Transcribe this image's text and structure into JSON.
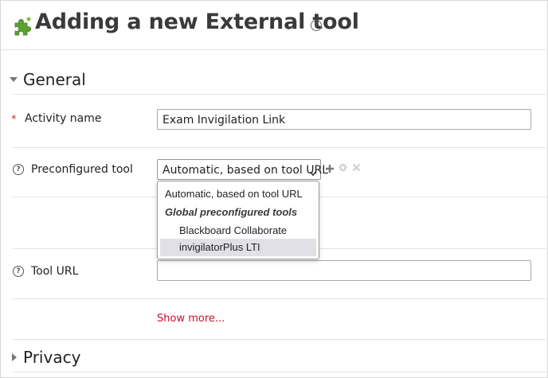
{
  "header": {
    "title": "Adding a new External tool",
    "help_glyph": "?"
  },
  "sections": {
    "general": {
      "label": "General"
    },
    "privacy": {
      "label": "Privacy"
    }
  },
  "form": {
    "activity_name": {
      "label": "Activity name",
      "required_marker": "*",
      "value": "Exam Invigilation Link"
    },
    "preconfigured_tool": {
      "label": "Preconfigured tool",
      "selected": "Automatic, based on tool URL",
      "options": [
        {
          "label": "Automatic, based on tool URL",
          "kind": "option"
        },
        {
          "label": "Global preconfigured tools",
          "kind": "group"
        },
        {
          "label": "Blackboard Collaborate",
          "kind": "option"
        },
        {
          "label": "invigilatorPlus LTI",
          "kind": "option",
          "highlighted": true
        }
      ]
    },
    "tool_url": {
      "label": "Tool URL",
      "value": ""
    },
    "show_more": "Show more..."
  },
  "icons": {
    "title_icon": "puzzle-piece-icon",
    "help": "question-circle-icon",
    "add": "plus-icon",
    "configure": "gear-icon",
    "remove": "x-icon"
  },
  "colors": {
    "required": "#ca3120",
    "link": "#c8102e",
    "highlight": "#e0e0e6",
    "puzzle": "#5da130"
  }
}
